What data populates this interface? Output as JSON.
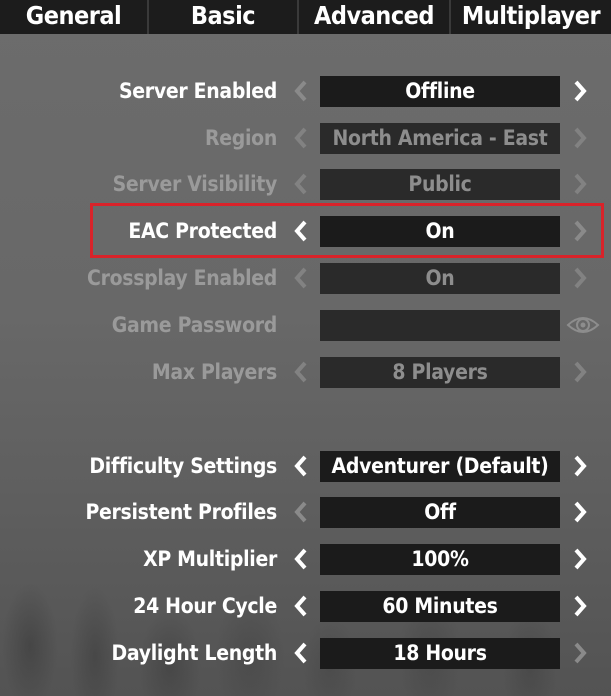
{
  "tabs": [
    {
      "label": "General"
    },
    {
      "label": "Basic"
    },
    {
      "label": "Advanced"
    },
    {
      "label": "Multiplayer"
    }
  ],
  "settings": [
    {
      "label": "Server Enabled",
      "value": "Offline"
    },
    {
      "label": "Region",
      "value": "North America - East"
    },
    {
      "label": "Server Visibility",
      "value": "Public"
    },
    {
      "label": "EAC Protected",
      "value": "On"
    },
    {
      "label": "Crossplay Enabled",
      "value": "On"
    },
    {
      "label": "Game Password",
      "value": ""
    },
    {
      "label": "Max Players",
      "value": "8 Players"
    },
    {
      "label": "Difficulty Settings",
      "value": "Adventurer (Default)"
    },
    {
      "label": "Persistent Profiles",
      "value": "Off"
    },
    {
      "label": "XP Multiplier",
      "value": "100%"
    },
    {
      "label": "24 Hour Cycle",
      "value": "60 Minutes"
    },
    {
      "label": "Daylight Length",
      "value": "18 Hours"
    }
  ],
  "icons": {
    "left": "chevron-left-icon",
    "right": "chevron-right-icon",
    "password": "eye-icon"
  },
  "colors": {
    "highlight": "#d9232a",
    "field": "#1b1b1b",
    "tab": "#1c1c1c",
    "text": "#ffffff",
    "disabled": "#9a9a9a"
  }
}
